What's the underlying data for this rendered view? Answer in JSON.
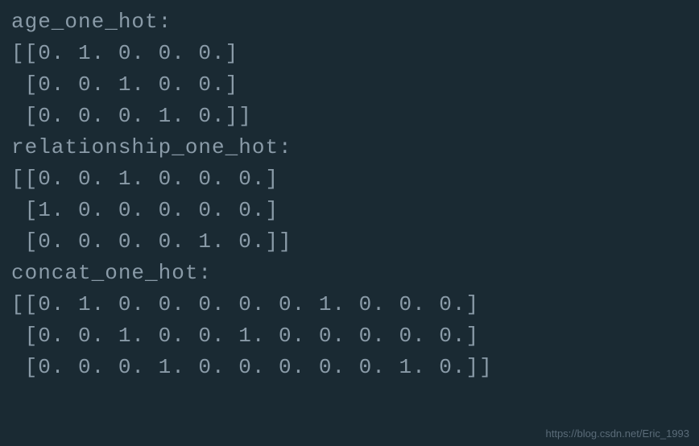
{
  "output": {
    "lines": [
      "age_one_hot:",
      "[[0. 1. 0. 0. 0.]",
      " [0. 0. 1. 0. 0.]",
      " [0. 0. 0. 1. 0.]]",
      "relationship_one_hot:",
      "[[0. 0. 1. 0. 0. 0.]",
      " [1. 0. 0. 0. 0. 0.]",
      " [0. 0. 0. 0. 1. 0.]]",
      "concat_one_hot:",
      "[[0. 1. 0. 0. 0. 0. 0. 1. 0. 0. 0.]",
      " [0. 0. 1. 0. 0. 1. 0. 0. 0. 0. 0.]",
      " [0. 0. 0. 1. 0. 0. 0. 0. 0. 1. 0.]]"
    ]
  },
  "watermark": "https://blog.csdn.net/Eric_1993"
}
